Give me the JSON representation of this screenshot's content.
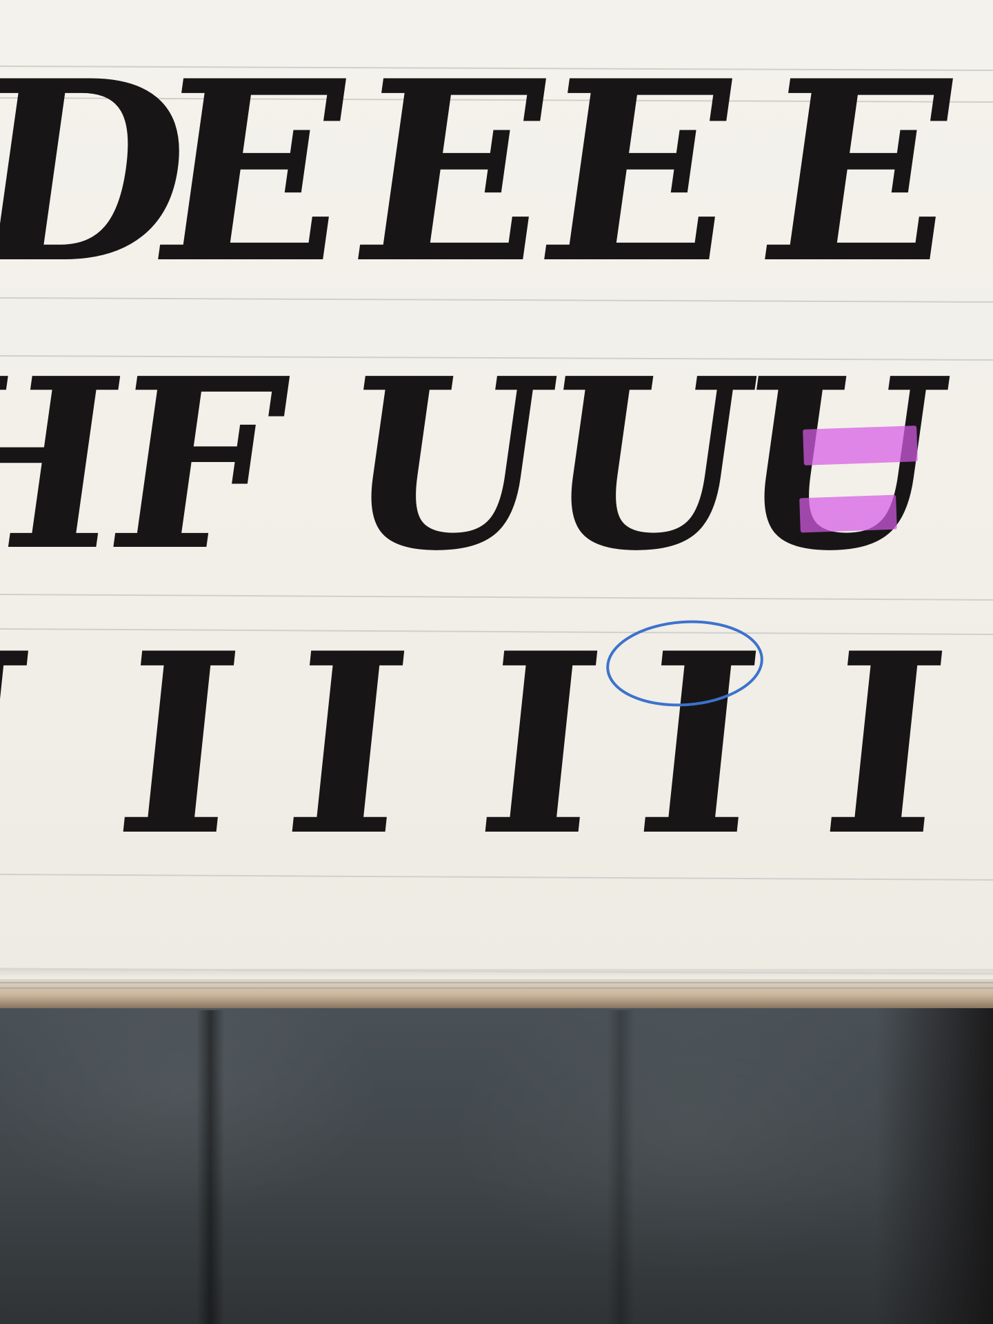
{
  "scene": {
    "description_type": "calligraphy practice sheet photo",
    "rows": [
      {
        "letters": [
          "D",
          "E",
          "E",
          "E",
          "E"
        ]
      },
      {
        "letters": [
          "H",
          "F",
          "U",
          "U",
          "U"
        ]
      },
      {
        "letters": [
          "J",
          "I",
          "I",
          "I",
          "I",
          "I"
        ]
      }
    ],
    "annotations": {
      "circle_color": "#3d72cc",
      "highlight_color": "#d65ce6",
      "ink_color": "#181516"
    }
  }
}
